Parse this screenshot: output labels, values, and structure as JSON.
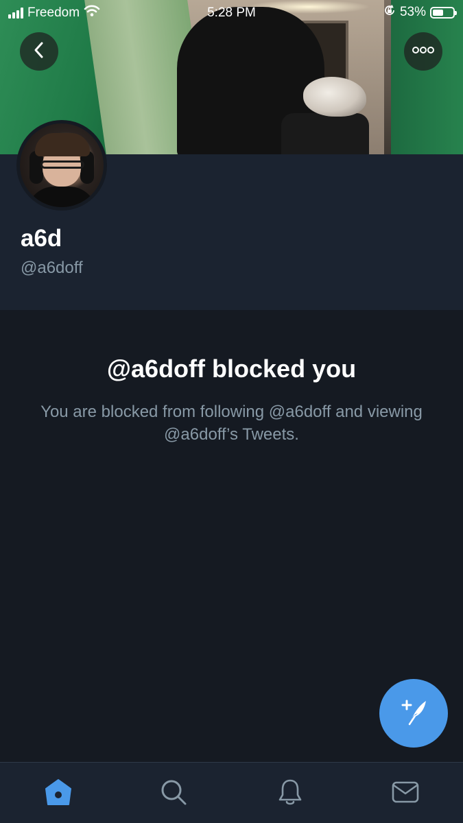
{
  "status_bar": {
    "carrier": "Freedom",
    "time": "5:28 PM",
    "battery_percent": "53%",
    "battery_level": 0.53,
    "icons": [
      "signal-bars-icon",
      "wifi-icon",
      "orientation-lock-icon",
      "battery-icon"
    ]
  },
  "profile": {
    "display_name": "a6d",
    "handle": "@a6doff"
  },
  "blocked": {
    "title": "@a6doff blocked you",
    "description": "You are blocked from following @a6doff and viewing @a6doff’s Tweets."
  },
  "header_buttons": {
    "back_icon": "chevron-left-icon",
    "more_icon": "more-dots-icon"
  },
  "compose_button": {
    "icon": "compose-tweet-icon"
  },
  "tab_bar": {
    "active": "home",
    "items": [
      {
        "id": "home",
        "icon": "home-icon"
      },
      {
        "id": "search",
        "icon": "search-icon"
      },
      {
        "id": "notifications",
        "icon": "bell-icon"
      },
      {
        "id": "messages",
        "icon": "mail-icon"
      }
    ]
  },
  "colors": {
    "background": "#151a22",
    "header_background": "#1b2330",
    "secondary_text": "#8899a6",
    "accent": "#4a99e9",
    "tab_inactive": "#8899a6"
  }
}
